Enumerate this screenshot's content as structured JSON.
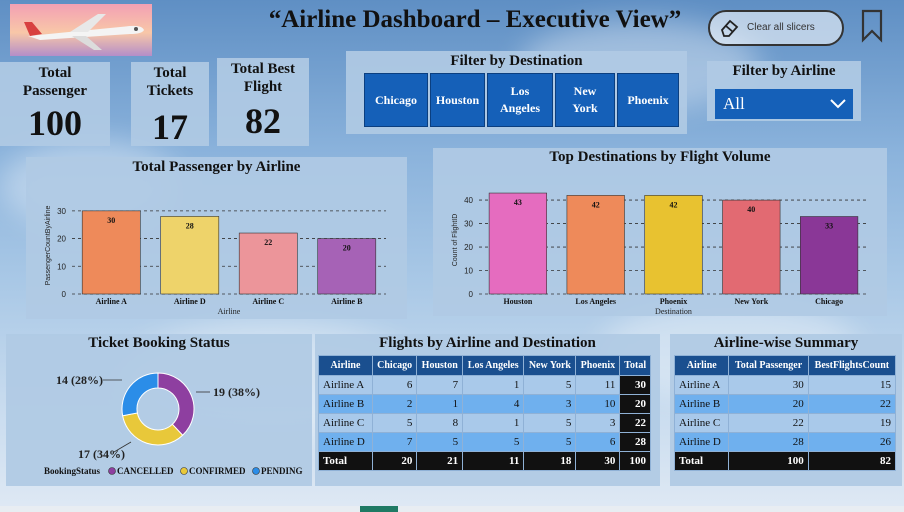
{
  "header": {
    "title": "“Airline Dashboard – Executive View”",
    "clear_slicers_label": "Clear all slicers"
  },
  "kpis": [
    {
      "label": "Total Passenger",
      "value": "100"
    },
    {
      "label": "Total Tickets",
      "value": "17"
    },
    {
      "label": "Total Best Flight",
      "value": "82"
    }
  ],
  "destination_filter": {
    "title": "Filter by Destination",
    "options": [
      "Chicago",
      "Houston",
      "Los Angeles",
      "New York",
      "Phoenix"
    ]
  },
  "airline_filter": {
    "title": "Filter by Airline",
    "selected": "All"
  },
  "colors": {
    "accent": "#1560b8",
    "header_dark": "#1a4f8f",
    "cancelled": "#8e3fa0",
    "confirmed": "#e8c83a",
    "pending": "#2b8de8"
  },
  "chart_data": [
    {
      "type": "bar",
      "title": "Total Passenger by Airline",
      "categories": [
        "Airline A",
        "Airline D",
        "Airline C",
        "Airline B"
      ],
      "values": [
        30,
        28,
        22,
        20
      ],
      "colors": [
        "#ee8a5a",
        "#eed36a",
        "#ec959a",
        "#a662b6"
      ],
      "xlabel": "Airline",
      "ylabel": "PassengerCountByAirline",
      "ylim": [
        0,
        35
      ],
      "yticks": [
        0,
        10,
        20,
        30
      ],
      "grid": true
    },
    {
      "type": "bar",
      "title": "Top Destinations by Flight Volume",
      "categories": [
        "Houston",
        "Los Angeles",
        "Phoenix",
        "New York",
        "Chicago"
      ],
      "values": [
        43,
        42,
        42,
        40,
        33
      ],
      "colors": [
        "#e56cbf",
        "#ee8a5a",
        "#e8c230",
        "#e26a72",
        "#8a3797"
      ],
      "xlabel": "Destination",
      "ylabel": "Count of FlightID",
      "ylim": [
        0,
        46
      ],
      "yticks": [
        0,
        10,
        20,
        30,
        40
      ],
      "grid": true
    },
    {
      "type": "pie",
      "title": "Ticket Booking Status",
      "legend_title": "BookingStatus",
      "categories": [
        "CANCELLED",
        "CONFIRMED",
        "PENDING"
      ],
      "values": [
        19,
        17,
        14
      ],
      "percent_labels": [
        "19 (38%)",
        "17 (34%)",
        "14 (28%)"
      ],
      "colors": [
        "#8e3fa0",
        "#e8c83a",
        "#2b8de8"
      ]
    }
  ],
  "matrix": {
    "title": "Flights by Airline and Destination",
    "columns": [
      "Airline",
      "Chicago",
      "Houston",
      "Los Angeles",
      "New York",
      "Phoenix",
      "Total"
    ],
    "rows": [
      [
        "Airline A",
        "6",
        "7",
        "1",
        "5",
        "11",
        "30"
      ],
      [
        "Airline B",
        "2",
        "1",
        "4",
        "3",
        "10",
        "20"
      ],
      [
        "Airline C",
        "5",
        "8",
        "1",
        "5",
        "3",
        "22"
      ],
      [
        "Airline D",
        "7",
        "5",
        "5",
        "5",
        "6",
        "28"
      ]
    ],
    "total_row": [
      "Total",
      "20",
      "21",
      "11",
      "18",
      "30",
      "100"
    ]
  },
  "summary": {
    "title": "Airline-wise Summary",
    "columns": [
      "Airline",
      "Total Passenger",
      "BestFlightsCount"
    ],
    "rows": [
      [
        "Airline A",
        "30",
        "15"
      ],
      [
        "Airline B",
        "20",
        "22"
      ],
      [
        "Airline C",
        "22",
        "19"
      ],
      [
        "Airline D",
        "28",
        "26"
      ]
    ],
    "total_row": [
      "Total",
      "100",
      "82"
    ]
  }
}
